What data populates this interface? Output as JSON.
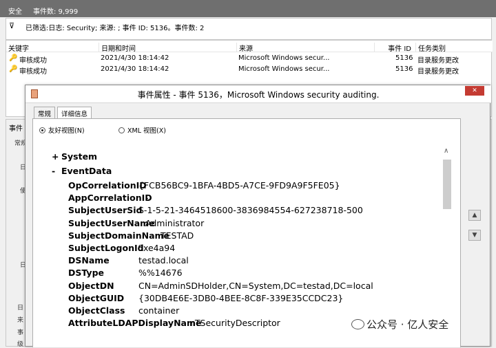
{
  "window": {
    "title": "安全",
    "event_count": "事件数: 9,999"
  },
  "filter": {
    "text": "已筛选:日志: Security; 来源: ; 事件 ID: 5136。事件数: 2"
  },
  "list": {
    "headers": [
      "关键字",
      "日期和时间",
      "来源",
      "事件 ID",
      "任务类别"
    ],
    "rows": [
      {
        "keyword": "审核成功",
        "date": "2021/4/30 18:14:42",
        "source": "Microsoft Windows secur...",
        "id": "5136",
        "category": "目录服务更改"
      },
      {
        "keyword": "审核成功",
        "date": "2021/4/30 18:14:42",
        "source": "Microsoft Windows secur...",
        "id": "5136",
        "category": "目录服务更改"
      }
    ]
  },
  "lower": {
    "header": "事件",
    "tab_fragment": "常规",
    "side_labels": [
      "日",
      "使",
      "日",
      "日",
      "来",
      "事",
      "级"
    ]
  },
  "dialog": {
    "title": "事件属性 - 事件 5136，Microsoft Windows security auditing.",
    "close": "✕",
    "tabs": [
      "常规",
      "详细信息"
    ],
    "radio_friendly": "友好视图(N)",
    "radio_xml": "XML 视图(X)",
    "system_label": "System",
    "system_toggle": "+",
    "eventdata_label": "EventData",
    "eventdata_toggle": "-",
    "fields": [
      {
        "k": "OpCorrelationID",
        "v": "{FCB56BC9-1BFA-4BD5-A7CE-9FD9A9F5FE05}"
      },
      {
        "k": "AppCorrelationID",
        "v": "-"
      },
      {
        "k": "SubjectUserSid",
        "v": "S-1-5-21-3464518600-3836984554-627238718-500"
      },
      {
        "k": "SubjectUserName",
        "v": "Administrator"
      },
      {
        "k": "SubjectDomainName",
        "v": "TESTAD"
      },
      {
        "k": "SubjectLogonId",
        "v": "0xe4a94"
      },
      {
        "k": "DSName",
        "v": "testad.local"
      },
      {
        "k": "DSType",
        "v": "%%14676"
      },
      {
        "k": "ObjectDN",
        "v": "CN=AdminSDHolder,CN=System,DC=testad,DC=local"
      },
      {
        "k": "ObjectGUID",
        "v": "{30DB4E6E-3DB0-4BEE-8C8F-339E35CCDC23}"
      },
      {
        "k": "ObjectClass",
        "v": "container"
      },
      {
        "k": "AttributeLDAPDisplayName",
        "v": "nTSecurityDescriptor"
      }
    ]
  },
  "watermark": "公众号 · 亿人安全"
}
